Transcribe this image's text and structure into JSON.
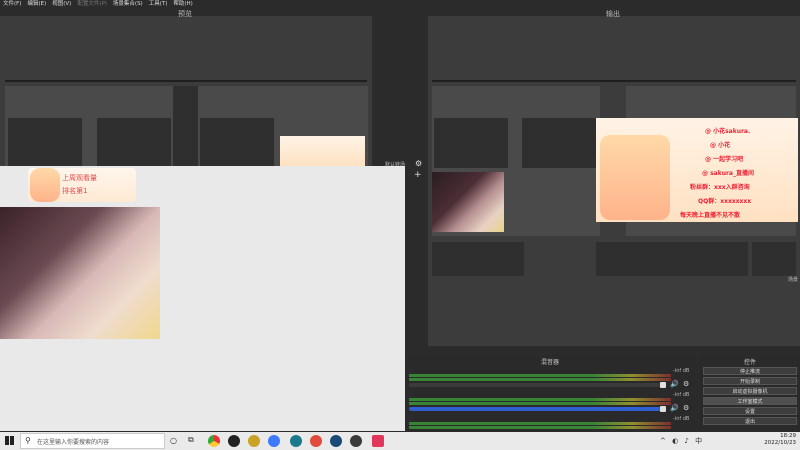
{
  "menu": {
    "items": [
      "文件(F)",
      "编辑(E)",
      "视图(V)",
      "配置文件(P)",
      "场景集合(S)",
      "工具(T)",
      "帮助(H)"
    ],
    "disabled_index": 3
  },
  "panes": {
    "preview_label": "预览",
    "program_label": "输出"
  },
  "studio": {
    "transition_label": "默认转场",
    "right_edge_label": "场景"
  },
  "overlay": {
    "lines": [
      "@ 小花sakura.",
      "@ 小花",
      "@ 一起学习吧",
      "@ sakura_直播间",
      "粉丝群：xxx入群咨询",
      "QQ群：xxxxxxxx",
      "每天晚上直播不见不散"
    ]
  },
  "float_tag": {
    "line1": "上周观看量",
    "line2": "排名第1"
  },
  "mixer": {
    "title": "混音器",
    "ch1_db": "-inf dB",
    "ch2_db": "-inf dB",
    "ch3_db": "-inf dB"
  },
  "controls": {
    "title": "控件",
    "buttons": [
      "停止推流",
      "开始录制",
      "启动虚拟摄像机",
      "工作室模式",
      "设置",
      "退出"
    ]
  },
  "taskbar": {
    "search_placeholder": "在这里输入你要搜索的内容",
    "time": "18:29",
    "date": "2022/10/23"
  },
  "colors": {
    "chrome_bg": "#2b2b2b",
    "pane_bg": "#3c3c3c",
    "meter_green": "#3a9a3a",
    "fader_blue": "#2f5fd0",
    "taskbar_bg": "#eaeaea",
    "accent_red": "#e5484d"
  },
  "icons": [
    "windows-logo-icon",
    "search-icon",
    "cortana-icon",
    "task-view-icon",
    "chrome-icon",
    "obs-icon",
    "steam-icon",
    "app-icon"
  ]
}
